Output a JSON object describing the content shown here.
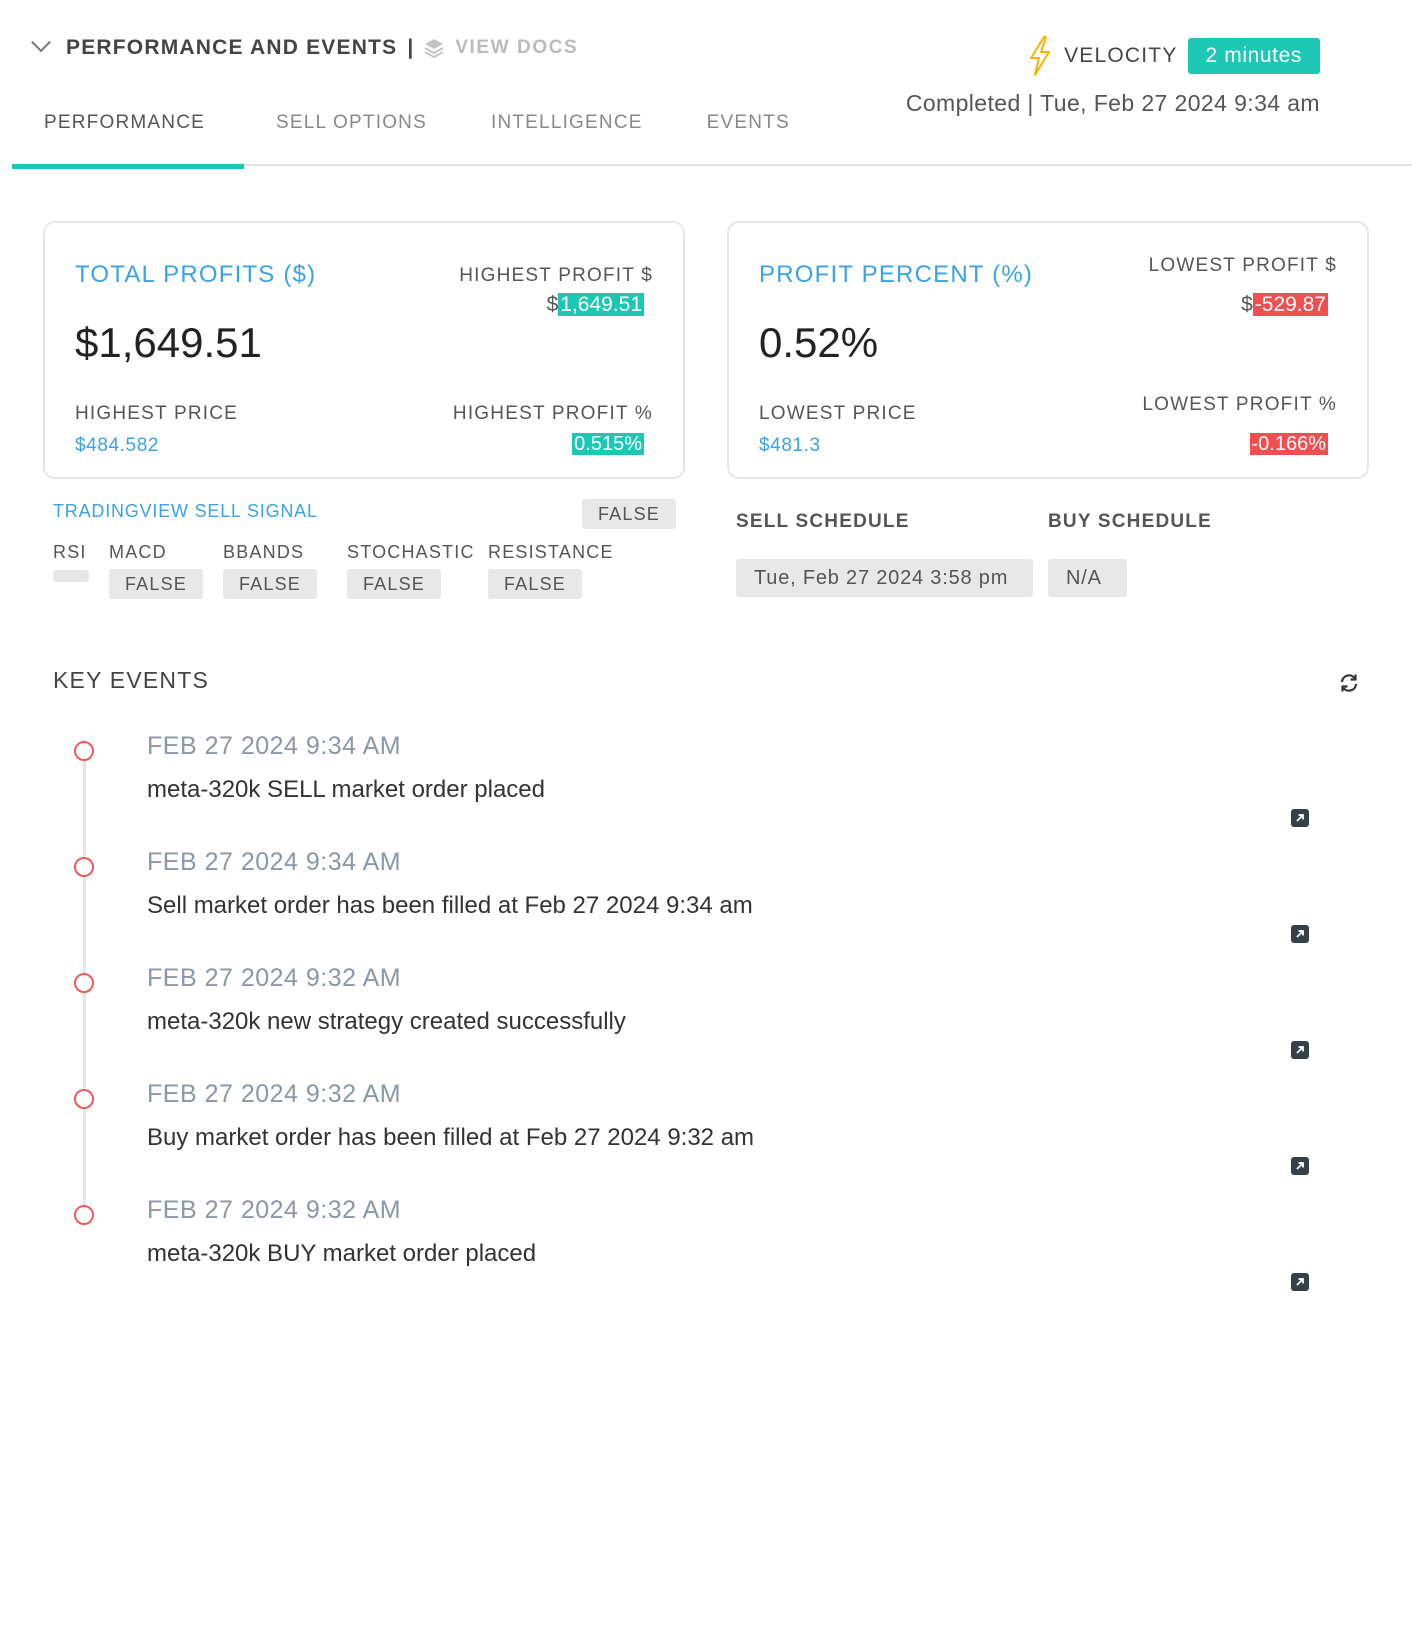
{
  "header": {
    "title": "PERFORMANCE AND EVENTS",
    "separator": "|",
    "docs_link": "VIEW DOCS",
    "velocity_label": "VELOCITY",
    "velocity_value": "2 minutes",
    "status": "Completed | Tue, Feb 27 2024 9:34 am"
  },
  "tabs": [
    {
      "label": "PERFORMANCE",
      "active": true
    },
    {
      "label": "SELL OPTIONS",
      "active": false
    },
    {
      "label": "INTELLIGENCE",
      "active": false
    },
    {
      "label": "EVENTS",
      "active": false
    }
  ],
  "profits_card": {
    "title": "TOTAL PROFITS ($)",
    "value": "$1,649.51",
    "highest_profit_label": "HIGHEST PROFIT $",
    "highest_profit_prefix": "$",
    "highest_profit_value": "1,649.51",
    "highest_price_label": "HIGHEST PRICE",
    "highest_price_value": "$484.582",
    "highest_profit_pct_label": "HIGHEST PROFIT %",
    "highest_profit_pct_value": "0.515%"
  },
  "percent_card": {
    "title": "PROFIT PERCENT (%)",
    "value": "0.52%",
    "lowest_profit_label": "LOWEST PROFIT $",
    "lowest_profit_prefix": "$",
    "lowest_profit_value": "-529.87",
    "lowest_price_label": "LOWEST PRICE",
    "lowest_price_value": "$481.3",
    "lowest_profit_pct_label": "LOWEST PROFIT %",
    "lowest_profit_pct_value": "-0.166%"
  },
  "signals": {
    "tradingview_label": "TRADINGVIEW SELL SIGNAL",
    "tradingview_value": "FALSE",
    "indicators": [
      {
        "label": "RSI",
        "value": ""
      },
      {
        "label": "MACD",
        "value": "FALSE"
      },
      {
        "label": "BBANDS",
        "value": "FALSE"
      },
      {
        "label": "STOCHASTIC",
        "value": "FALSE"
      },
      {
        "label": "RESISTANCE",
        "value": "FALSE"
      }
    ]
  },
  "schedule": {
    "sell_label": "SELL SCHEDULE",
    "sell_value": "Tue, Feb 27 2024 3:58 pm",
    "buy_label": "BUY SCHEDULE",
    "buy_value": "N/A"
  },
  "key_events": {
    "title": "KEY EVENTS",
    "items": [
      {
        "time": "FEB 27 2024 9:34 AM",
        "text": "meta-320k SELL market order placed"
      },
      {
        "time": "FEB 27 2024 9:34 AM",
        "text": "Sell market order has been filled at Feb 27 2024 9:34 am"
      },
      {
        "time": "FEB 27 2024 9:32 AM",
        "text": "meta-320k new strategy created successfully"
      },
      {
        "time": "FEB 27 2024 9:32 AM",
        "text": "Buy market order has been filled at Feb 27 2024 9:32 am"
      },
      {
        "time": "FEB 27 2024 9:32 AM",
        "text": "meta-320k BUY market order placed"
      }
    ]
  },
  "colors": {
    "accent_teal": "#1cc8b5",
    "accent_blue": "#3aa3e3",
    "negative_red": "#ef4f4f",
    "velocity_bolt": "#f5b400"
  },
  "icons": [
    "chevron-down-icon",
    "layers-icon",
    "lightning-bolt-icon",
    "refresh-icon",
    "external-link-icon"
  ]
}
